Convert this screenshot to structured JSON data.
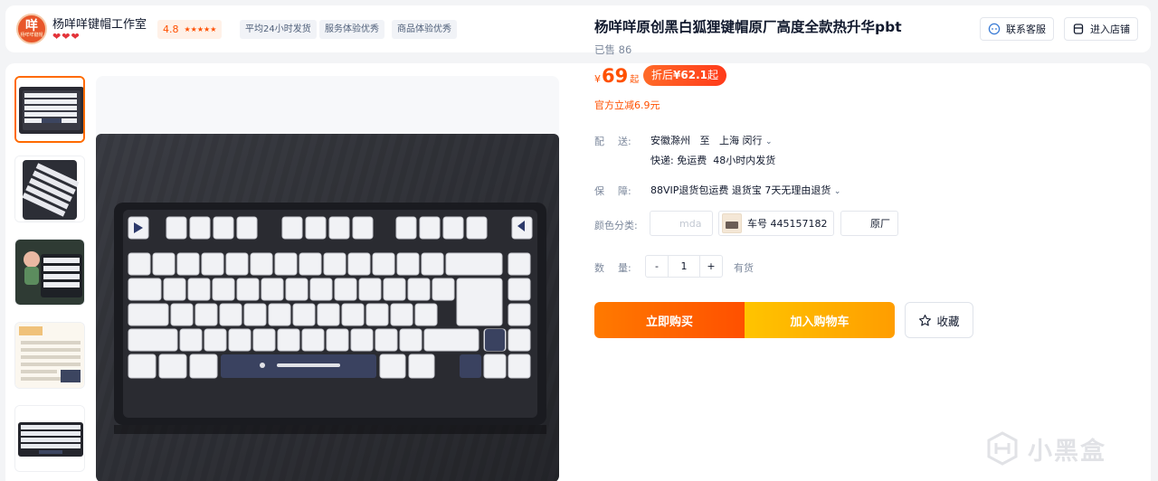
{
  "shop": {
    "logo_char": "咩",
    "logo_sub": "杨咩咩键帽",
    "name": "杨咩咩键帽工作室",
    "hearts": [
      "❤",
      "❤",
      "❤"
    ],
    "rating": "4.8",
    "stars": "★★★★★",
    "tags": [
      "平均24小时发货",
      "服务体验优秀",
      "商品体验优秀"
    ],
    "contact_label": "联系客服",
    "enter_label": "进入店铺"
  },
  "product": {
    "title": "杨咩咩原创黑白狐狸键帽原厂高度全款热升华pbt",
    "sold": "已售 86",
    "price_symbol": "¥",
    "price": "69",
    "price_suffix": "起",
    "discount_prefix": "折后",
    "discount_price": "¥62.1",
    "discount_suffix": "起",
    "official_reduce": "官方立减6.9元"
  },
  "delivery": {
    "label_a": "配",
    "label_b": "送:",
    "from": "安徽滁州",
    "to_word": "至",
    "to": "上海 闵行",
    "shipping": "快递: 免运费",
    "ship_time": "48小时内发货"
  },
  "guarantee": {
    "label_a": "保",
    "label_b": "障:",
    "text": "88VIP退货包运费 退货宝 7天无理由退货"
  },
  "sku": {
    "label": "颜色分类:",
    "options": [
      {
        "label": "mda",
        "disabled": true
      },
      {
        "label": "车号 445157182",
        "disabled": false,
        "has_image": true
      },
      {
        "label": "原厂",
        "disabled": false
      }
    ]
  },
  "quantity": {
    "label_a": "数",
    "label_b": "量:",
    "minus": "-",
    "value": "1",
    "plus": "+",
    "stock": "有货"
  },
  "actions": {
    "buy_now": "立即购买",
    "add_cart": "加入购物车",
    "favorite": "收藏"
  },
  "watermark": "小黑盒",
  "colors": {
    "accent": "#ff5000",
    "cart": "#ffb100",
    "text": "#11192d",
    "muted": "#7c889c"
  }
}
